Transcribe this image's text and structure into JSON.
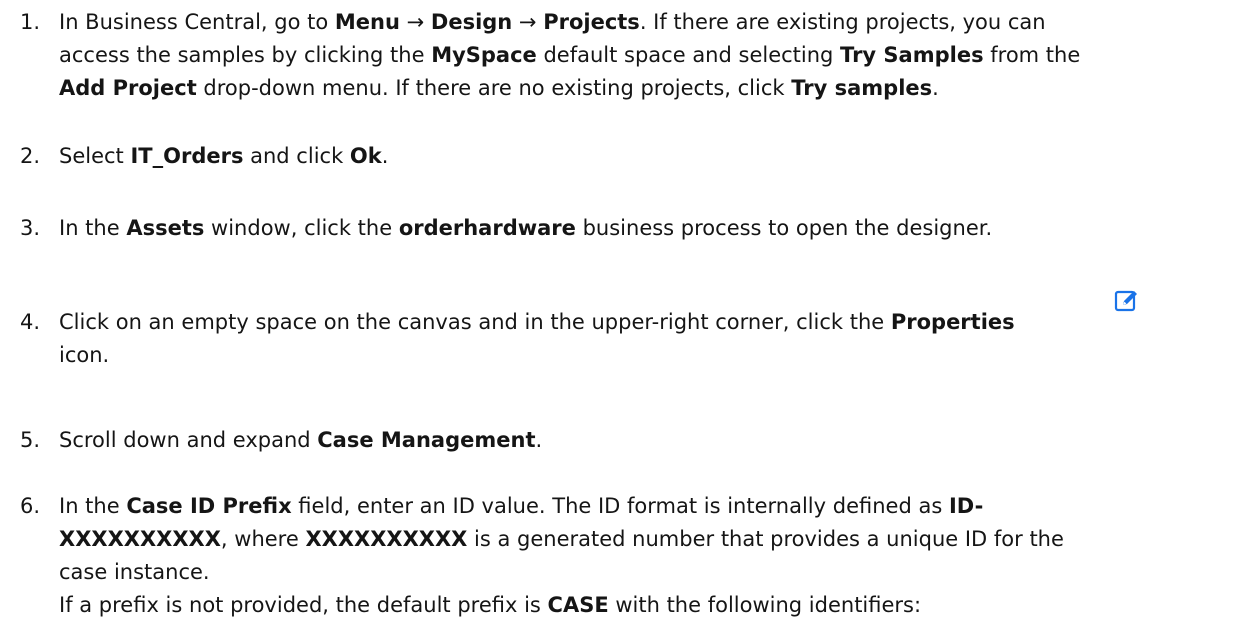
{
  "steps": [
    {
      "number": "1.",
      "t1": "In Business Central, go to ",
      "menu": "Menu",
      "arrow1": " → ",
      "design": "Design",
      "arrow2": " → ",
      "projects": "Projects",
      "t2": ". If there are existing projects, you can",
      "t3": "access the samples by clicking the ",
      "myspace": "MySpace",
      "t4": " default space and selecting ",
      "try_samples": "Try Samples",
      "t5": " from the",
      "add_project": "Add Project",
      "t6": " drop-down menu. If there are no existing projects, click ",
      "try_samples_2": "Try samples",
      "t7": "."
    },
    {
      "number": "2.",
      "t1": "Select ",
      "it_orders": "IT_Orders",
      "t2": " and click ",
      "ok": "Ok",
      "t3": "."
    },
    {
      "number": "3.",
      "t1": "In the ",
      "assets": "Assets",
      "t2": " window, click the ",
      "orderhardware": "orderhardware",
      "t3": " business process to open the designer."
    },
    {
      "number": "4.",
      "t1": "Click on an empty space on the canvas and in the upper-right corner, click the ",
      "properties": "Properties",
      "t2": "icon.",
      "icon": "edit-icon"
    },
    {
      "number": "5.",
      "t1": "Scroll down and expand ",
      "case_management": "Case Management",
      "t2": "."
    },
    {
      "number": "6.",
      "t1": "In the ",
      "case_id_prefix": "Case ID Prefix",
      "t2": " field, enter an ID value. The ID format is internally defined as ",
      "id_a": "ID-",
      "id_b": "XXXXXXXXXX",
      "t3": ", where ",
      "xxx": "XXXXXXXXXX",
      "t4": " is a generated number that provides a unique ID for the",
      "t5": "case instance.",
      "t6": "If a prefix is not provided, the default prefix is ",
      "case": "CASE",
      "t7": " with the following identifiers:"
    }
  ],
  "colors": {
    "text": "#151515",
    "icon": "#1a73e8"
  }
}
